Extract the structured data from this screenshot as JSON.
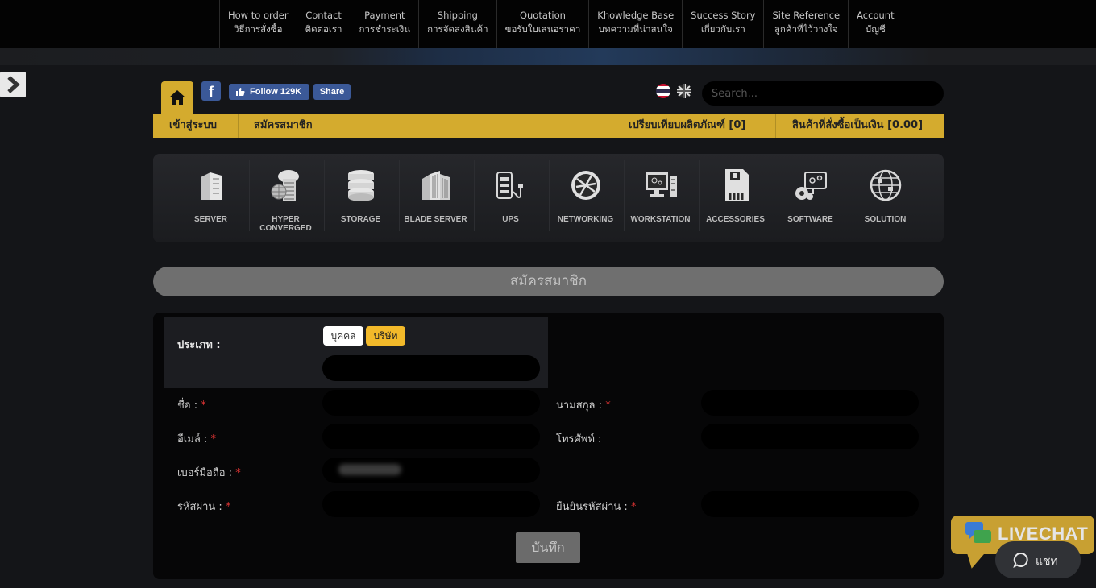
{
  "topnav": [
    {
      "en": "How to order",
      "th": "วิธีการสั่งซื้อ"
    },
    {
      "en": "Contact",
      "th": "ติดต่อเรา"
    },
    {
      "en": "Payment",
      "th": "การชำระเงิน"
    },
    {
      "en": "Shipping",
      "th": "การจัดส่งสินค้า"
    },
    {
      "en": "Quotation",
      "th": "ขอรับใบเสนอราคา"
    },
    {
      "en": "Khowledge Base",
      "th": "บทความที่น่าสนใจ"
    },
    {
      "en": "Success Story",
      "th": "เกี่ยวกับเรา"
    },
    {
      "en": "Site Reference",
      "th": "ลูกค้าที่ไว้วางใจ"
    },
    {
      "en": "Account",
      "th": "บัญชี"
    }
  ],
  "social": {
    "follow_label": "Follow 129K",
    "share_label": "Share"
  },
  "search": {
    "placeholder": "Search..."
  },
  "goldbar": {
    "login": "เข้าสู่ระบบ",
    "register": "สมัครสมาชิก",
    "compare": "เปรียบเทียบผลิตภัณฑ์ [0]",
    "cart": "สินค้าที่สั่งซื้อเป็นเงิน [0.00]"
  },
  "categories": [
    {
      "label": "SERVER",
      "icon": "server-icon"
    },
    {
      "label": "HYPER CONVERGED",
      "icon": "hyper-converged-icon"
    },
    {
      "label": "STORAGE",
      "icon": "storage-icon"
    },
    {
      "label": "BLADE SERVER",
      "icon": "blade-server-icon"
    },
    {
      "label": "UPS",
      "icon": "ups-icon"
    },
    {
      "label": "NETWORKING",
      "icon": "networking-icon"
    },
    {
      "label": "WORKSTATION",
      "icon": "workstation-icon"
    },
    {
      "label": "ACCESSORIES",
      "icon": "accessories-icon"
    },
    {
      "label": "SOFTWARE",
      "icon": "software-icon"
    },
    {
      "label": "SOLUTION",
      "icon": "solution-icon"
    }
  ],
  "section_title": "สมัครสมาชิก",
  "form": {
    "type_label": "ประเภท :",
    "type_options": [
      "บุคคล",
      "บริษัท"
    ],
    "type_selected": "บริษัท",
    "first_name_label": "ชื่อ :",
    "last_name_label": "นามสกุล :",
    "email_label": "อีเมล์ :",
    "phone_label": "โทรศัพท์ :",
    "mobile_label": "เบอร์มือถือ :",
    "password_label": "รหัสผ่าน :",
    "confirm_password_label": "ยืนยันรหัสผ่าน :",
    "required_mark": "*",
    "save_label": "บันทึก"
  },
  "livechat": {
    "banner_text": "LIVECHAT",
    "chat_label": "แชท"
  },
  "colors": {
    "accent_gold": "#d4ab2e",
    "selected_pill": "#f2b92a",
    "facebook_blue": "#3b5998",
    "background": "#141518"
  }
}
